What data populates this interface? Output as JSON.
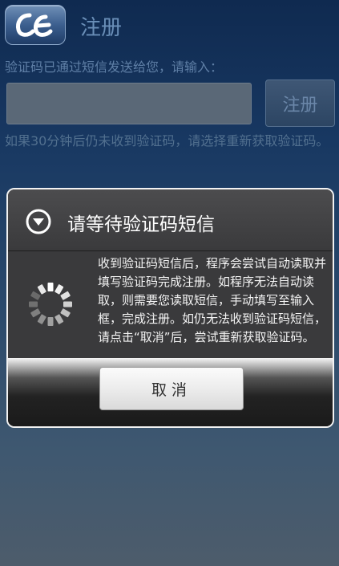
{
  "header": {
    "app_icon": "app-logo-icon",
    "title": "注册"
  },
  "form": {
    "hint": "验证码已通过短信发送给您，请输入：",
    "code_value": "",
    "register_button": "注册",
    "retry_hint": "如果30分钟后仍未收到验证码，请选择重新获取验证码。"
  },
  "dialog": {
    "icon": "chevron-down-circle-icon",
    "title": "请等待验证码短信",
    "spinner": "loading-spinner-icon",
    "message": "收到验证码短信后，程序会尝试自动读取并填写验证码完成注册。如程序无法自动读取，则需要您读取短信，手动填写至输入框，完成注册。如仍无法收到验证码短信，请点击“取消”后，尝试重新获取验证码。",
    "cancel_button": "取消"
  }
}
